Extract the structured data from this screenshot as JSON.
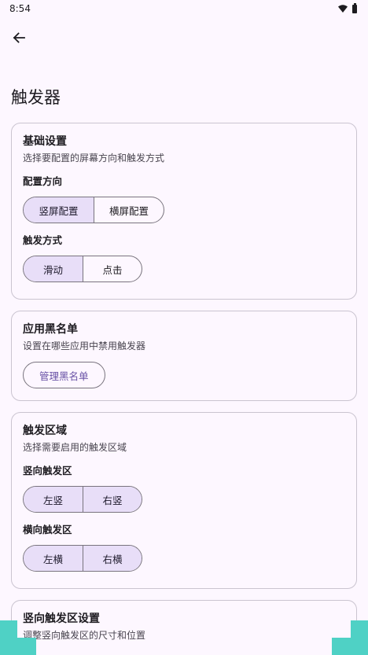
{
  "status_bar": {
    "time": "8:54"
  },
  "icons": {
    "back": "arrow-left-icon",
    "wifi": "wifi-icon",
    "battery": "battery-icon"
  },
  "colors": {
    "background": "#fdf7ff",
    "selected": "#e8def8",
    "accent": "#6750a4",
    "outline": "#79747e",
    "deco": "#4fd1c5"
  },
  "page": {
    "title": "触发器"
  },
  "basic_settings": {
    "title": "基础设置",
    "subtitle": "选择要配置的屏幕方向和触发方式",
    "orientation_label": "配置方向",
    "orientation_options": [
      "竖屏配置",
      "横屏配置"
    ],
    "orientation_selected": "竖屏配置",
    "trigger_mode_label": "触发方式",
    "trigger_mode_options": [
      "滑动",
      "点击"
    ],
    "trigger_mode_selected": "滑动"
  },
  "blacklist": {
    "title": "应用黑名单",
    "subtitle": "设置在哪些应用中禁用触发器",
    "manage_button": "管理黑名单"
  },
  "trigger_area": {
    "title": "触发区域",
    "subtitle": "选择需要启用的触发区域",
    "vertical_label": "竖向触发区",
    "vertical_options": [
      "左竖",
      "右竖"
    ],
    "vertical_selected": [
      "左竖",
      "右竖"
    ],
    "horizontal_label": "横向触发区",
    "horizontal_options": [
      "左横",
      "右横"
    ],
    "horizontal_selected": [
      "左横"
    ]
  },
  "vertical_settings": {
    "title": "竖向触发区设置",
    "subtitle": "调整竖向触发区的尺寸和位置"
  }
}
